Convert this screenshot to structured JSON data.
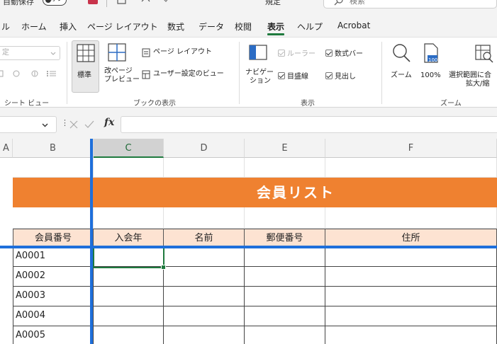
{
  "titlebar": {
    "autosave_label": "自動保存",
    "autosave_state": "オフ",
    "file_status": "規定",
    "search_placeholder": "検索"
  },
  "menu": {
    "tabs": [
      {
        "label": "ル"
      },
      {
        "label": "ホーム"
      },
      {
        "label": "挿入"
      },
      {
        "label": "ページ レイアウト"
      },
      {
        "label": "数式"
      },
      {
        "label": "データ"
      },
      {
        "label": "校閲"
      },
      {
        "label": "表示",
        "active": true
      },
      {
        "label": "ヘルプ"
      },
      {
        "label": "Acrobat"
      }
    ]
  },
  "ribbon": {
    "sheet_view": {
      "dropdown_value": "定",
      "group_label": "シート ビュー"
    },
    "workbook_views": {
      "normal": "標準",
      "page_break_line1": "改ページ",
      "page_break_line2": "プレビュー",
      "page_layout": "ページ レイアウト",
      "custom_views": "ユーザー設定のビュー",
      "group_label": "ブックの表示"
    },
    "show": {
      "navigation_line1": "ナビゲー",
      "navigation_line2": "ション",
      "ruler": "ルーラー",
      "formula_bar": "数式バー",
      "gridlines": "目盛線",
      "headings": "見出し",
      "group_label": "表示"
    },
    "zoom": {
      "zoom": "ズーム",
      "hundred": "100%",
      "zoom_to_selection_line1": "選択範囲に合",
      "zoom_to_selection_line2": "拡大/縮",
      "icon_text": "100",
      "group_label": "ズーム"
    }
  },
  "formula_bar": {
    "fx": "fx",
    "value": ""
  },
  "sheet": {
    "columns": [
      {
        "label": "A"
      },
      {
        "label": "B"
      },
      {
        "label": "C",
        "selected": true
      },
      {
        "label": "D"
      },
      {
        "label": "E"
      },
      {
        "label": "F"
      }
    ],
    "banner_title": "会員リスト",
    "headers": [
      "会員番号",
      "入会年",
      "名前",
      "郵便番号",
      "住所"
    ],
    "rows": [
      [
        "A0001",
        "",
        "",
        "",
        ""
      ],
      [
        "A0002",
        "",
        "",
        "",
        ""
      ],
      [
        "A0003",
        "",
        "",
        "",
        ""
      ],
      [
        "A0004",
        "",
        "",
        "",
        ""
      ],
      [
        "A0005",
        "",
        "",
        "",
        ""
      ]
    ],
    "colors": {
      "banner": "#ef8130",
      "header_fill": "#fde3d2",
      "freeze_line": "#1e6fdb",
      "accent": "#1f7a3e"
    }
  }
}
